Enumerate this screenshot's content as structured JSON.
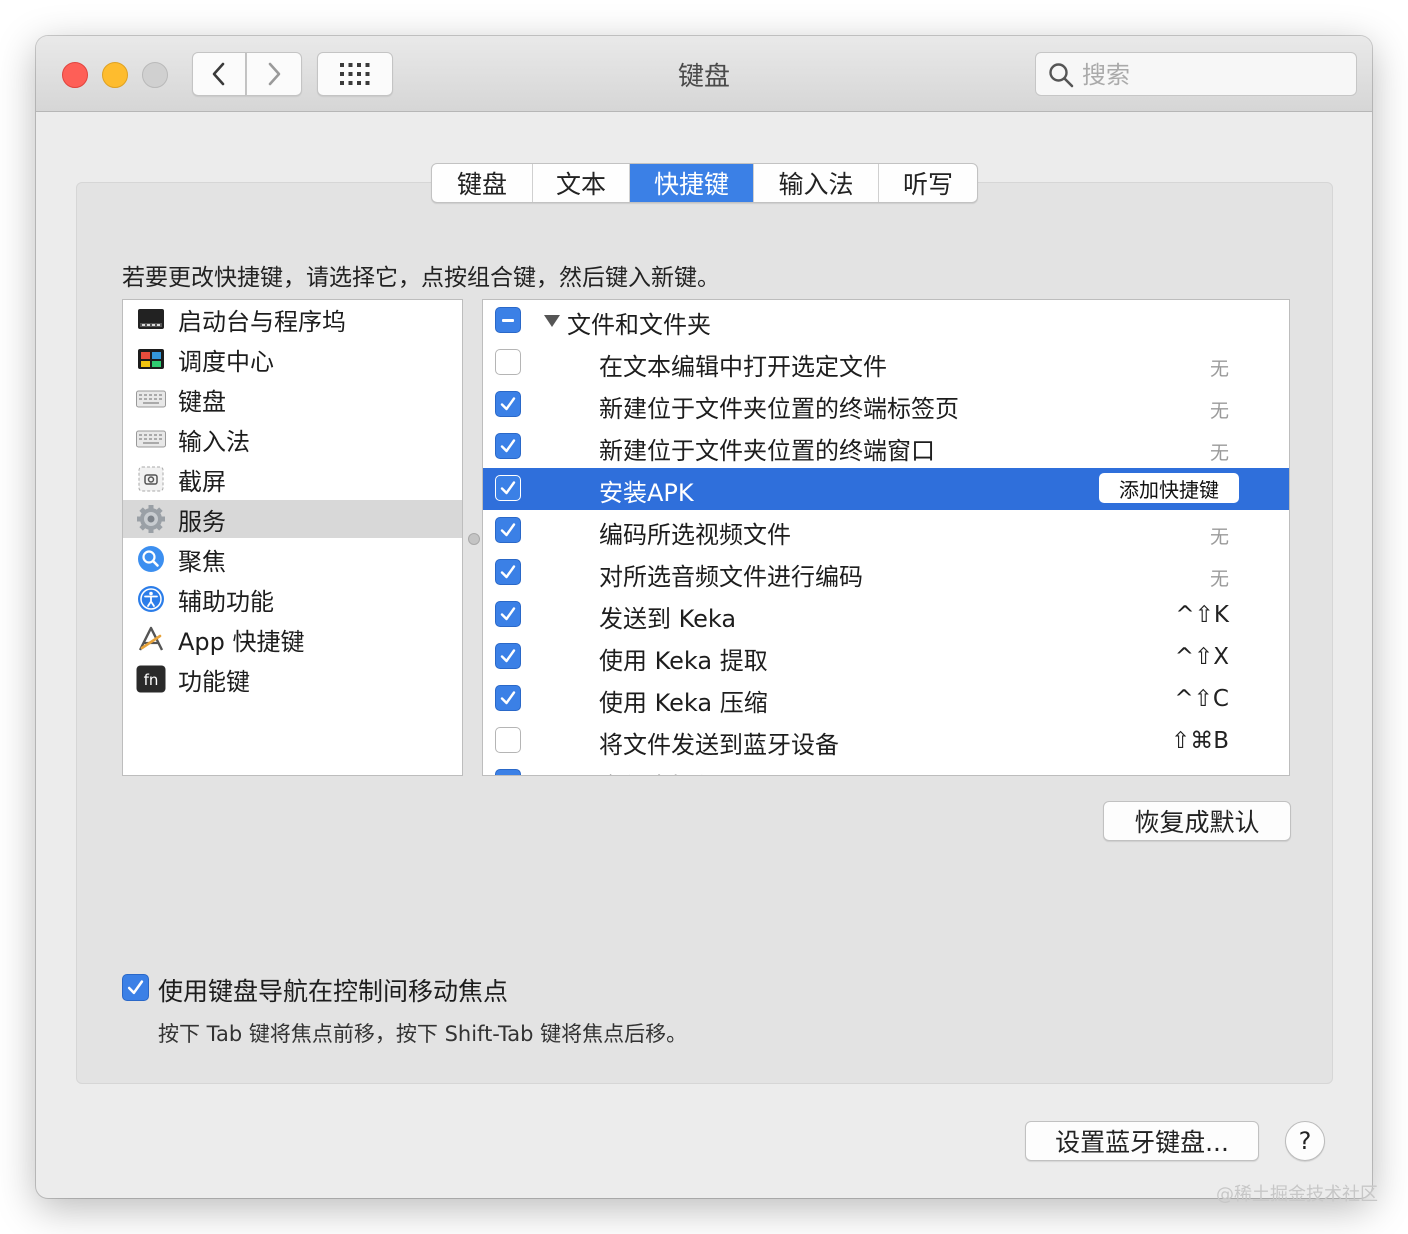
{
  "window": {
    "title": "键盘",
    "search_placeholder": "搜索"
  },
  "tabs": [
    {
      "label": "键盘"
    },
    {
      "label": "文本"
    },
    {
      "label": "快捷键"
    },
    {
      "label": "输入法"
    },
    {
      "label": "听写"
    }
  ],
  "active_tab": "快捷键",
  "instruction": "若要更改快捷键，请选择它，点按组合键，然后键入新键。",
  "categories": [
    {
      "label": "启动台与程序坞",
      "icon": "launchpad-dock-icon"
    },
    {
      "label": "调度中心",
      "icon": "mission-control-icon"
    },
    {
      "label": "键盘",
      "icon": "keyboard-icon"
    },
    {
      "label": "输入法",
      "icon": "input-source-icon"
    },
    {
      "label": "截屏",
      "icon": "screenshot-icon"
    },
    {
      "label": "服务",
      "icon": "services-gear-icon"
    },
    {
      "label": "聚焦",
      "icon": "spotlight-icon"
    },
    {
      "label": "辅助功能",
      "icon": "accessibility-icon"
    },
    {
      "label": "App 快捷键",
      "icon": "app-shortcuts-icon"
    },
    {
      "label": "功能键",
      "icon": "fn-key-icon"
    }
  ],
  "selected_category": "服务",
  "shortcuts": {
    "group_label": "文件和文件夹",
    "rows": [
      {
        "label": "在文本编辑中打开选定文件",
        "checked": false,
        "shortcut": "无"
      },
      {
        "label": "新建位于文件夹位置的终端标签页",
        "checked": true,
        "shortcut": "无"
      },
      {
        "label": "新建位于文件夹位置的终端窗口",
        "checked": true,
        "shortcut": "无"
      },
      {
        "label": "安装APK",
        "checked": true,
        "shortcut": "",
        "selected": true,
        "add_button": "添加快捷键"
      },
      {
        "label": "编码所选视频文件",
        "checked": true,
        "shortcut": "无"
      },
      {
        "label": "对所选音频文件进行编码",
        "checked": true,
        "shortcut": "无"
      },
      {
        "label": "发送到 Keka",
        "checked": true,
        "shortcut": "^⇧K"
      },
      {
        "label": "使用 Keka 提取",
        "checked": true,
        "shortcut": "^⇧X"
      },
      {
        "label": "使用 Keka 压缩",
        "checked": true,
        "shortcut": "^⇧C"
      },
      {
        "label": "将文件发送到蓝牙设备",
        "checked": false,
        "shortcut": "⇧⌘B"
      },
      {
        "label": "文件夹操作设置",
        "checked": true,
        "shortcut": ""
      }
    ]
  },
  "restore_button": "恢复成默认",
  "keyboard_nav": {
    "label": "使用键盘导航在控制间移动焦点",
    "checked": true,
    "hint": "按下 Tab 键将焦点前移，按下 Shift-Tab 键将焦点后移。"
  },
  "bluetooth_button": "设置蓝牙键盘...",
  "help_label": "?",
  "watermark": "@稀土掘金技术社区",
  "colors": {
    "accent": "#3b80e6",
    "selected_row": "#2f6fdb",
    "close": "#fe5f57",
    "minimize": "#febc2e"
  }
}
